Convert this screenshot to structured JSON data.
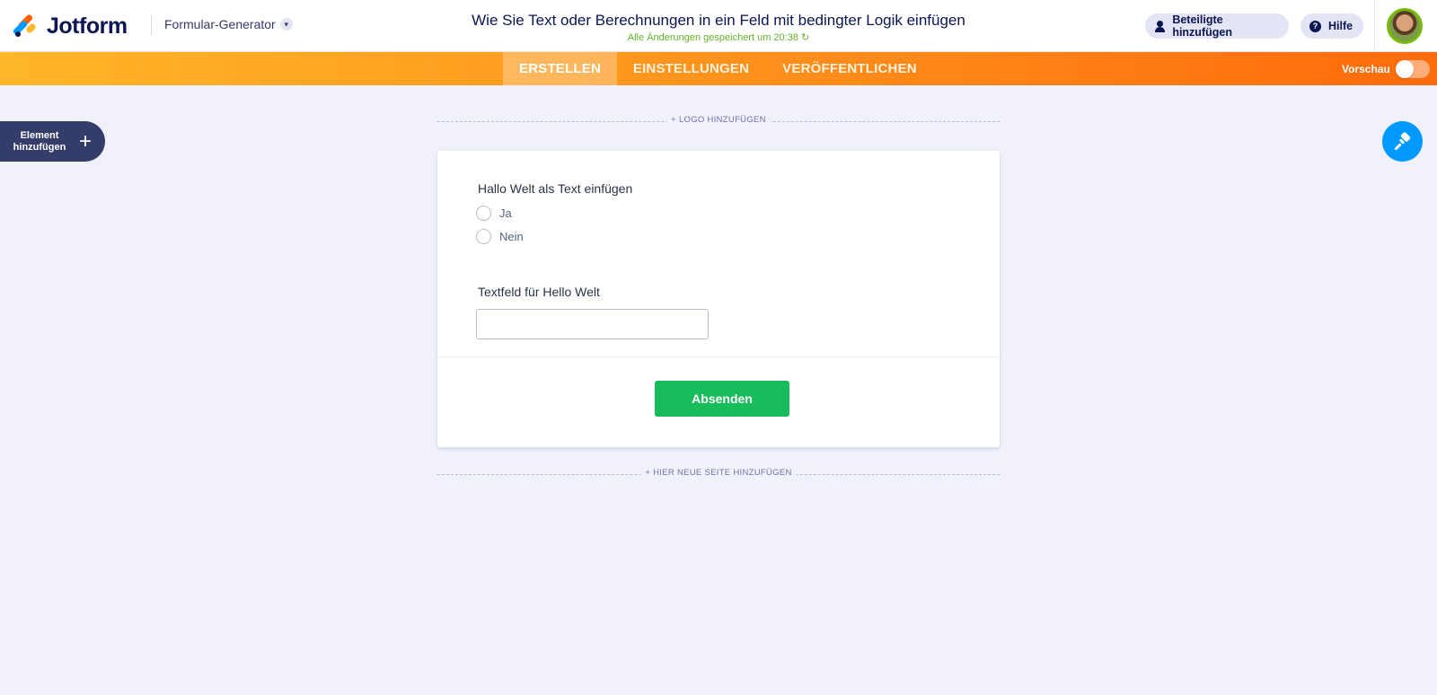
{
  "header": {
    "logo_text": "Jotform",
    "builder_menu_label": "Formular-Generator",
    "form_title": "Wie Sie Text oder Berechnungen in ein Feld mit bedingter Logik einfügen",
    "save_status": "Alle Änderungen gespeichert um 20:38",
    "invite_label": "Beteiligte hinzufügen",
    "help_label": "Hilfe"
  },
  "nav": {
    "tabs": [
      {
        "label": "ERSTELLEN",
        "active": true
      },
      {
        "label": "EINSTELLUNGEN",
        "active": false
      },
      {
        "label": "VERÖFFENTLICHEN",
        "active": false
      }
    ],
    "preview_label": "Vorschau",
    "preview_on": false
  },
  "sidebar": {
    "add_element_label_line1": "Element",
    "add_element_label_line2": "hinzufügen"
  },
  "canvas": {
    "add_logo_label": "+ LOGO HINZUFÜGEN",
    "add_page_label": "+ HIER NEUE SEITE HINZUFÜGEN"
  },
  "form": {
    "question1": {
      "label": "Hallo Welt als Text einfügen",
      "options": [
        "Ja",
        "Nein"
      ]
    },
    "question2": {
      "label": "Textfeld für Hello Welt",
      "value": ""
    },
    "submit_label": "Absenden"
  },
  "colors": {
    "brand_navy": "#0a1551",
    "nav_orange_start": "#ffb629",
    "nav_orange_end": "#ff6b0b",
    "submit_green": "#18bd5b",
    "designer_blue": "#0099ff",
    "save_green": "#64b22c"
  },
  "icons": {
    "logo": "jotform-logo-icon",
    "dropdown": "chevron-down-icon",
    "refresh": "refresh-icon",
    "invite": "user-icon",
    "help": "help-icon",
    "add": "plus-icon",
    "designer": "paint-roller-icon"
  }
}
